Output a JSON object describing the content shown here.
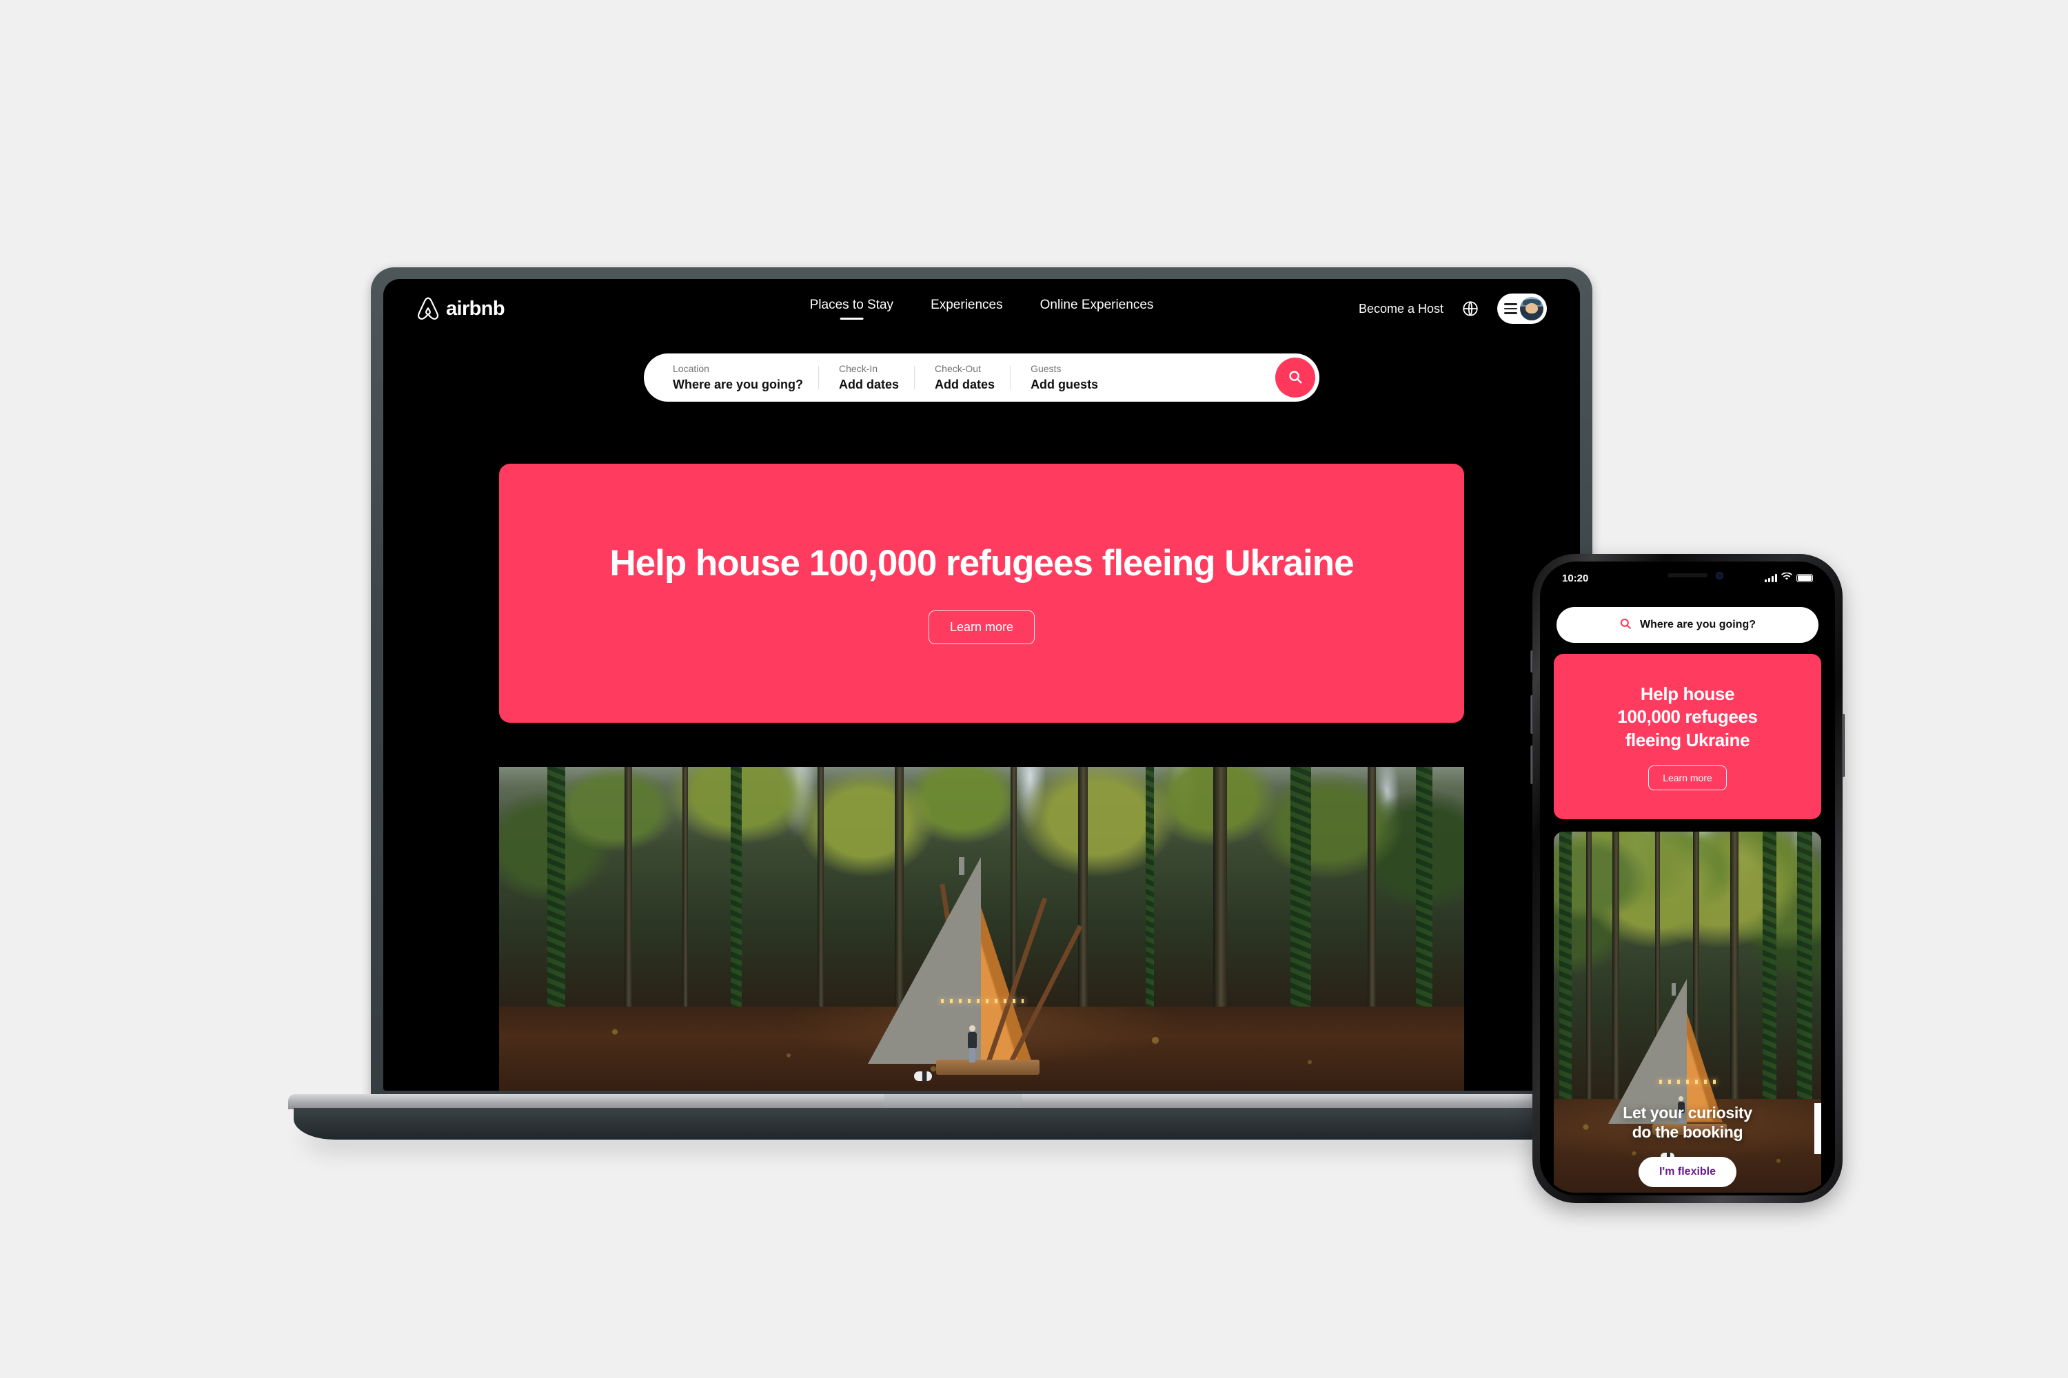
{
  "scene": {
    "background_color": "#f0f0f0",
    "devices": [
      "laptop",
      "smartphone"
    ]
  },
  "brand": {
    "name": "airbnb",
    "logo_icon": "airbnb-belo-icon",
    "accent_color": "#FF385C",
    "banner_color": "#FF3B5F"
  },
  "desktop": {
    "nav": {
      "links": [
        {
          "label": "Places to Stay",
          "active": true
        },
        {
          "label": "Experiences",
          "active": false
        },
        {
          "label": "Online Experiences",
          "active": false
        }
      ],
      "become_host": "Become a Host",
      "globe_icon": "globe-icon",
      "menu_icon": "hamburger-icon",
      "avatar_icon": "user-avatar"
    },
    "search": {
      "fields": [
        {
          "label": "Location",
          "value": "Where are you going?"
        },
        {
          "label": "Check-In",
          "value": "Add dates"
        },
        {
          "label": "Check-Out",
          "value": "Add dates"
        },
        {
          "label": "Guests",
          "value": "Add guests"
        }
      ],
      "search_icon": "search-icon"
    },
    "hero": {
      "title": "Help house 100,000 refugees fleeing Ukraine",
      "button": "Learn more"
    },
    "photo": {
      "alt": "A-frame cabin lit up at dusk in an autumn forest"
    }
  },
  "mobile": {
    "status": {
      "time": "10:20",
      "signal_icon": "cellular-bars-icon",
      "wifi_icon": "wifi-icon",
      "battery_icon": "battery-full-icon"
    },
    "search": {
      "placeholder": "Where are you going?",
      "search_icon": "search-icon"
    },
    "hero": {
      "title_lines": [
        "Help house",
        "100,000 refugees",
        "fleeing Ukraine"
      ],
      "button": "Learn more"
    },
    "photo": {
      "caption_lines": [
        "Let your curiosity",
        "do the booking"
      ],
      "cta": "I'm flexible",
      "cta_color": "#6b1a8c"
    }
  }
}
